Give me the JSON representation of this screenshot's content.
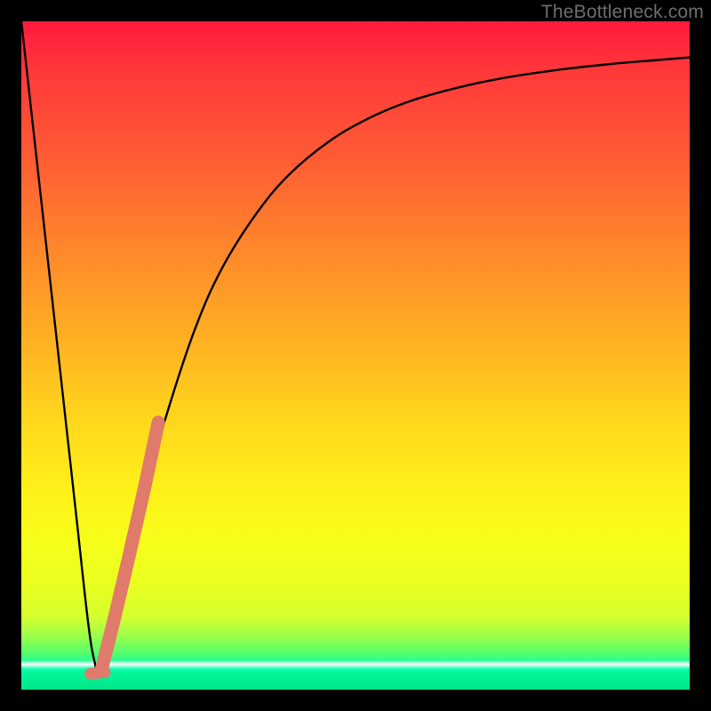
{
  "watermark": "TheBottleneck.com",
  "colors": {
    "background": "#000000",
    "curve_stroke": "#000000",
    "marker_stroke": "#e07a6a",
    "watermark_text": "#6e6e6e"
  },
  "chart_data": {
    "type": "line",
    "title": "",
    "xlabel": "",
    "ylabel": "",
    "xlim": [
      0,
      100
    ],
    "ylim": [
      0,
      100
    ],
    "grid": false,
    "series": [
      {
        "name": "bottleneck-curve",
        "x": [
          0,
          4,
          8,
          10,
          11,
          11.8,
          13,
          15,
          18,
          22,
          26,
          30,
          35,
          40,
          46,
          52,
          58,
          65,
          72,
          80,
          88,
          95,
          100
        ],
        "values": [
          100,
          64,
          28,
          10,
          4,
          2,
          6,
          14,
          28,
          42,
          54,
          63,
          71,
          77,
          82,
          85.5,
          88,
          90,
          91.5,
          92.7,
          93.6,
          94.2,
          94.6
        ]
      }
    ],
    "markers": [
      {
        "name": "highlight-segment",
        "x": [
          12.0,
          14.0,
          16.0,
          18.5,
          20.5
        ],
        "values": [
          3.0,
          11.0,
          19.5,
          30.5,
          40.0
        ]
      },
      {
        "name": "minimum-dot",
        "x": [
          10.3,
          12.5
        ],
        "values": [
          2.4,
          2.6
        ]
      }
    ],
    "gradient_stops_pct": [
      0,
      8,
      20,
      35,
      48,
      60,
      70,
      78,
      84,
      89,
      92,
      94.8,
      95.6,
      96.2,
      96.9,
      97.6,
      100
    ],
    "gradient_colors": [
      "#ff1a3c",
      "#ff3a3a",
      "#ff5a34",
      "#ff8a2a",
      "#ffb122",
      "#ffd81c",
      "#fff01a",
      "#f6ff1a",
      "#eaff20",
      "#d6ff2e",
      "#9cff4a",
      "#4dff72",
      "#2bff8f",
      "#ffffff",
      "#10ffb3",
      "#00f596",
      "#00e58a"
    ]
  }
}
